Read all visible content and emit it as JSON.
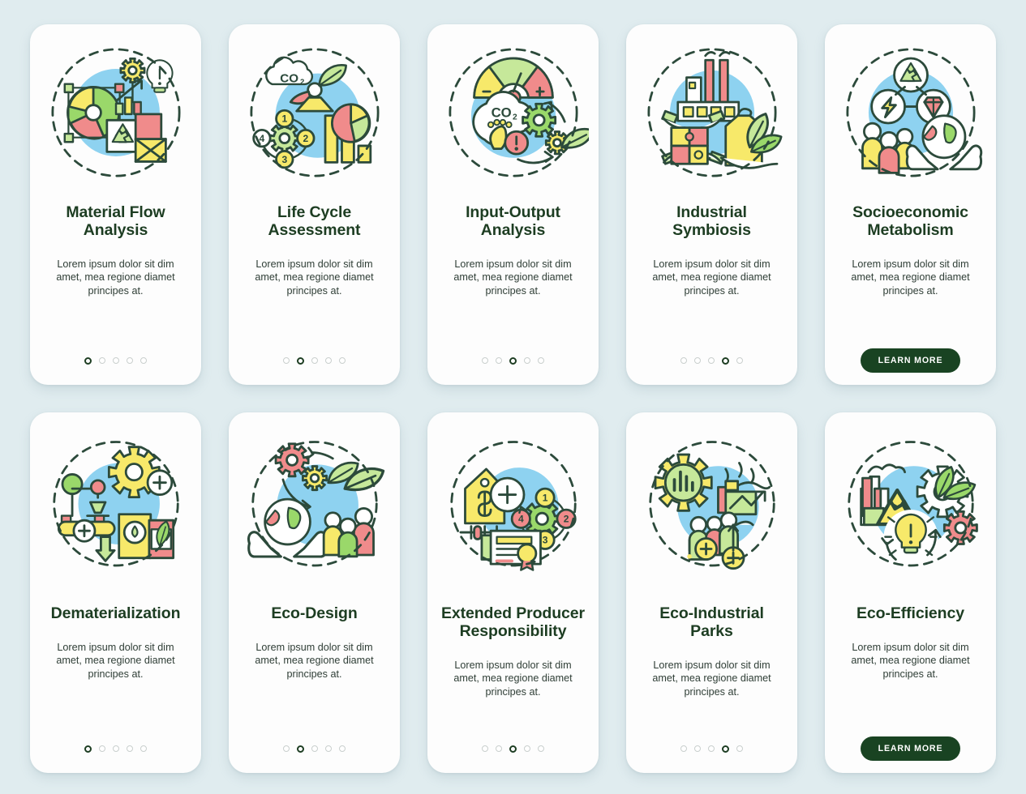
{
  "page": {
    "background_color": "#e0ecef",
    "card_background": "#fdfdfd",
    "title_color": "#1d3d22",
    "body_color": "#2f3e36",
    "accent_color": "#194322",
    "palette": {
      "blue": "#8ed2f0",
      "yellow": "#f7e96a",
      "green": "#9ad86a",
      "light_green": "#c6e89a",
      "red": "#f08b8b",
      "outline": "#2c4a3b"
    }
  },
  "screens": [
    {
      "id": "material-flow-analysis",
      "icon": "material-flow-analysis-illustration",
      "title": "Material Flow\nAnalysis",
      "title_line1": "Material Flow",
      "title_line2": "Analysis",
      "description": "Lorem ipsum dolor sit dim amet, mea regione diamet principes at.",
      "dots_total": 5,
      "dot_active": 1,
      "has_learn_more": false,
      "learn_more_label": ""
    },
    {
      "id": "life-cycle-assessment",
      "icon": "life-cycle-assessment-illustration",
      "title": "Life Cycle\nAssessment",
      "title_line1": "Life Cycle",
      "title_line2": "Assessment",
      "description": "Lorem ipsum dolor sit dim amet, mea regione diamet principes at.",
      "dots_total": 5,
      "dot_active": 2,
      "has_learn_more": false,
      "learn_more_label": ""
    },
    {
      "id": "input-output-analysis",
      "icon": "input-output-analysis-illustration",
      "title": "Input-Output\nAnalysis",
      "title_line1": "Input-Output",
      "title_line2": "Analysis",
      "description": "Lorem ipsum dolor sit dim amet, mea regione diamet principes at.",
      "dots_total": 5,
      "dot_active": 3,
      "has_learn_more": false,
      "learn_more_label": ""
    },
    {
      "id": "industrial-symbiosis",
      "icon": "industrial-symbiosis-illustration",
      "title": "Industrial\nSymbiosis",
      "title_line1": "Industrial",
      "title_line2": "Symbiosis",
      "description": "Lorem ipsum dolor sit dim amet, mea regione diamet principes at.",
      "dots_total": 5,
      "dot_active": 4,
      "has_learn_more": false,
      "learn_more_label": ""
    },
    {
      "id": "socioeconomic-metabolism",
      "icon": "socioeconomic-metabolism-illustration",
      "title": "Socioeconomic\nMetabolism",
      "title_line1": "Socioeconomic",
      "title_line2": "Metabolism",
      "description": "Lorem ipsum dolor sit dim amet, mea regione diamet principes at.",
      "dots_total": 0,
      "dot_active": 0,
      "has_learn_more": true,
      "learn_more_label": "LEARN MORE"
    },
    {
      "id": "dematerialization",
      "icon": "dematerialization-illustration",
      "title": "Dematerialization",
      "title_line1": "Dematerialization",
      "title_line2": "",
      "description": "Lorem ipsum dolor sit dim amet, mea regione diamet principes at.",
      "dots_total": 5,
      "dot_active": 1,
      "has_learn_more": false,
      "learn_more_label": ""
    },
    {
      "id": "eco-design",
      "icon": "eco-design-illustration",
      "title": "Eco-Design",
      "title_line1": "Eco-Design",
      "title_line2": "",
      "description": "Lorem ipsum dolor sit dim amet, mea regione diamet principes at.",
      "dots_total": 5,
      "dot_active": 2,
      "has_learn_more": false,
      "learn_more_label": ""
    },
    {
      "id": "extended-producer-responsibility",
      "icon": "extended-producer-responsibility-illustration",
      "title": "Extended Producer\nResponsibility",
      "title_line1": "Extended Producer",
      "title_line2": "Responsibility",
      "description": "Lorem ipsum dolor sit dim amet, mea regione diamet principes at.",
      "dots_total": 5,
      "dot_active": 3,
      "has_learn_more": false,
      "learn_more_label": ""
    },
    {
      "id": "eco-industrial-parks",
      "icon": "eco-industrial-parks-illustration",
      "title": "Eco-Industrial\nParks",
      "title_line1": "Eco-Industrial",
      "title_line2": "Parks",
      "description": "Lorem ipsum dolor sit dim amet, mea regione diamet principes at.",
      "dots_total": 5,
      "dot_active": 4,
      "has_learn_more": false,
      "learn_more_label": ""
    },
    {
      "id": "eco-efficiency",
      "icon": "eco-efficiency-illustration",
      "title": "Eco-Efficiency",
      "title_line1": "Eco-Efficiency",
      "title_line2": "",
      "description": "Lorem ipsum dolor sit dim amet, mea regione diamet principes at.",
      "dots_total": 0,
      "dot_active": 0,
      "has_learn_more": true,
      "learn_more_label": "LEARN MORE"
    }
  ]
}
